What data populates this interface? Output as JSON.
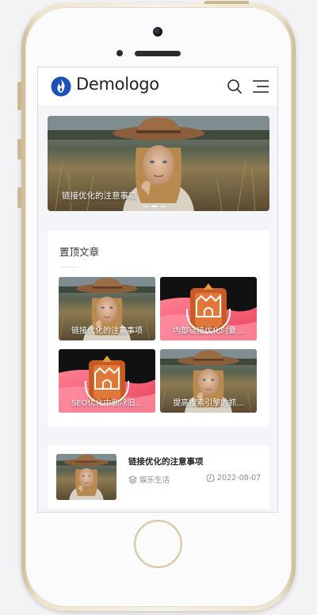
{
  "header": {
    "logo_text": "Demologo",
    "logo_color": "#1d4fb8"
  },
  "hero": {
    "caption": "链接优化的注意事项",
    "slides_count": 3,
    "active_slide": 1
  },
  "pinned": {
    "title": "置顶文章",
    "items": [
      {
        "caption": "链接优化的注意事项",
        "image": "woman-hat-photo"
      },
      {
        "caption": "内部链接优化时要...",
        "image": "castle-logo-pink"
      },
      {
        "caption": "SEO优化中删除旧...",
        "image": "castle-logo-pink"
      },
      {
        "caption": "提高搜索引擎的抓...",
        "image": "woman-hat-photo"
      }
    ]
  },
  "list": [
    {
      "title": "链接优化的注意事项",
      "category": "娱乐生活",
      "date": "2022-08-07",
      "image": "woman-hat-photo"
    }
  ],
  "colors": {
    "accent_pink": "#f0607a",
    "text_dark": "#222222",
    "text_muted": "#8a8a8a"
  }
}
